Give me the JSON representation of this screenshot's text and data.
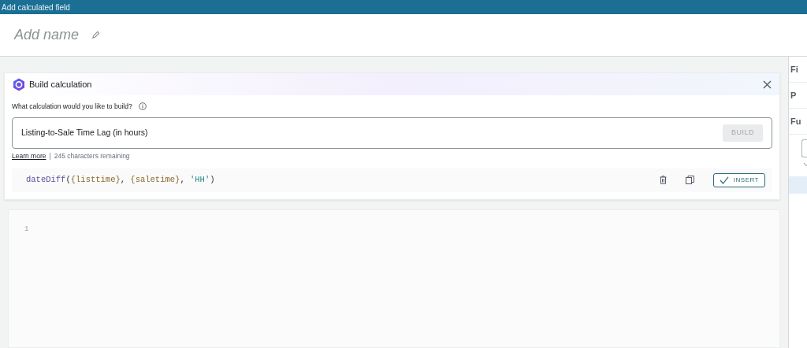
{
  "window": {
    "title": "Add calculated field"
  },
  "name_field": {
    "placeholder": "Add name"
  },
  "build_panel": {
    "title": "Build calculation",
    "prompt_label": "What calculation would you like to build?",
    "prompt_value": "Listing-to-Sale Time Lag (in hours)",
    "build_button": {
      "label": "BUILD",
      "disabled": true
    },
    "learn_more": "Learn more",
    "separator": "|",
    "remaining": "245 characters remaining",
    "suggestion": [
      {
        "kind": "function",
        "text": "dateDiff"
      },
      {
        "kind": "punct",
        "text": "("
      },
      {
        "kind": "field",
        "text": "{listtime}"
      },
      {
        "kind": "punct",
        "text": ", "
      },
      {
        "kind": "field",
        "text": "{saletime}"
      },
      {
        "kind": "punct",
        "text": ", "
      },
      {
        "kind": "string",
        "text": "'HH'"
      },
      {
        "kind": "punct",
        "text": ")"
      }
    ],
    "insert_button": "INSERT"
  },
  "editor": {
    "line_numbers": [
      "1"
    ]
  },
  "side_panel": {
    "sections": [
      "Fi",
      "P",
      "Fu"
    ]
  }
}
